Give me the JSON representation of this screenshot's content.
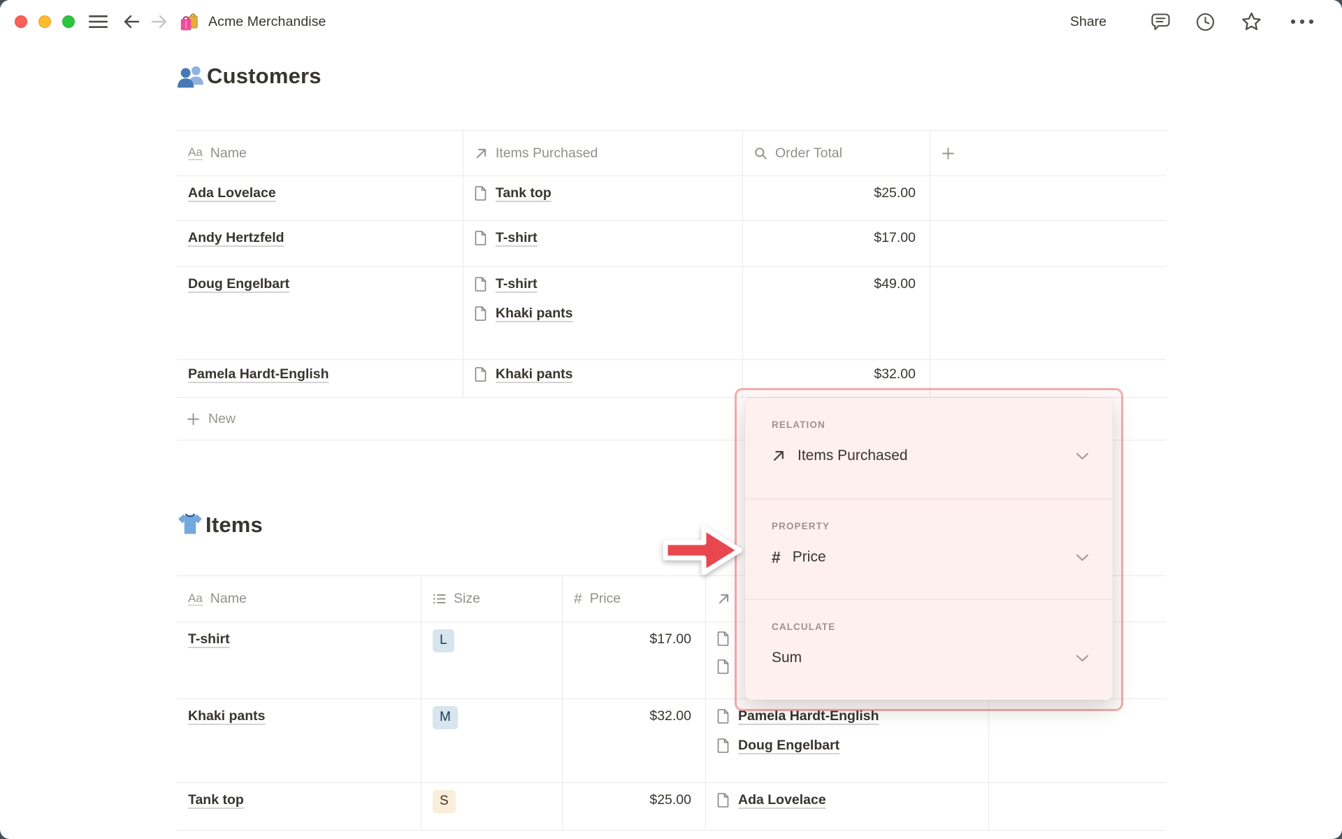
{
  "toolbar": {
    "title": "Acme Merchandise",
    "title_icon": "shopping-bags-icon",
    "share_label": "Share"
  },
  "customers_table": {
    "title": "Customers",
    "title_icon": "people-icon",
    "columns": [
      {
        "label": "Name",
        "icon": "text-property-icon"
      },
      {
        "label": "Items Purchased",
        "icon": "relation-arrow-icon"
      },
      {
        "label": "Order Total",
        "icon": "rollup-magnifier-icon"
      },
      {
        "label": "",
        "icon": "add-column-icon"
      }
    ],
    "rows": [
      {
        "name": "Ada Lovelace",
        "items_purchased": [
          "Tank top"
        ],
        "order_total": "$25.00"
      },
      {
        "name": "Andy Hertzfeld",
        "items_purchased": [
          "T-shirt"
        ],
        "order_total": "$17.00"
      },
      {
        "name": "Doug Engelbart",
        "items_purchased": [
          "T-shirt",
          "Khaki pants"
        ],
        "order_total": "$49.00"
      },
      {
        "name": "Pamela Hardt-English",
        "items_purchased": [
          "Khaki pants"
        ],
        "order_total": "$32.00"
      }
    ],
    "new_row_label": "New"
  },
  "items_table": {
    "title": "Items",
    "title_icon": "tshirt-icon",
    "columns": [
      {
        "label": "Name",
        "icon": "text-property-icon"
      },
      {
        "label": "Size",
        "icon": "select-property-icon"
      },
      {
        "label": "Price",
        "icon": "number-property-icon"
      },
      {
        "label": "",
        "icon": "relation-arrow-icon"
      }
    ],
    "rows": [
      {
        "name": "T-shirt",
        "size": "L",
        "size_tag_color": "#d7e5ee",
        "price": "$17.00",
        "purchased_by_visible": [],
        "hidden_link_icons": 2
      },
      {
        "name": "Khaki pants",
        "size": "M",
        "size_tag_color": "#d7e5ee",
        "price": "$32.00",
        "purchased_by_visible": [
          "Pamela Hardt-English",
          "Doug Engelbart"
        ]
      },
      {
        "name": "Tank top",
        "size": "S",
        "size_tag_color": "#faeeda",
        "price": "$25.00",
        "purchased_by_visible": [
          "Ada Lovelace"
        ]
      }
    ]
  },
  "rollup_popup": {
    "sections": [
      {
        "label": "RELATION",
        "value": "Items Purchased",
        "value_icon": "relation-arrow-icon"
      },
      {
        "label": "PROPERTY",
        "value": "Price",
        "value_icon": "number-property-icon"
      },
      {
        "label": "CALCULATE",
        "value": "Sum",
        "value_icon": null
      }
    ]
  },
  "annotation": {
    "arrow_direction": "right",
    "arrow_color": "#e8474e",
    "highlight_border_color": "#ef9d97",
    "popup_background": "#fdf0ee"
  },
  "colors": {
    "text": "#37352f",
    "muted_text": "#91908c",
    "table_border": "#e9e9e7",
    "tag_blue": "#d7e5ee",
    "tag_yellow": "#faeeda",
    "traffic_red": "#fe5f57",
    "traffic_yellow": "#febb2e",
    "traffic_green": "#2ac73f"
  }
}
